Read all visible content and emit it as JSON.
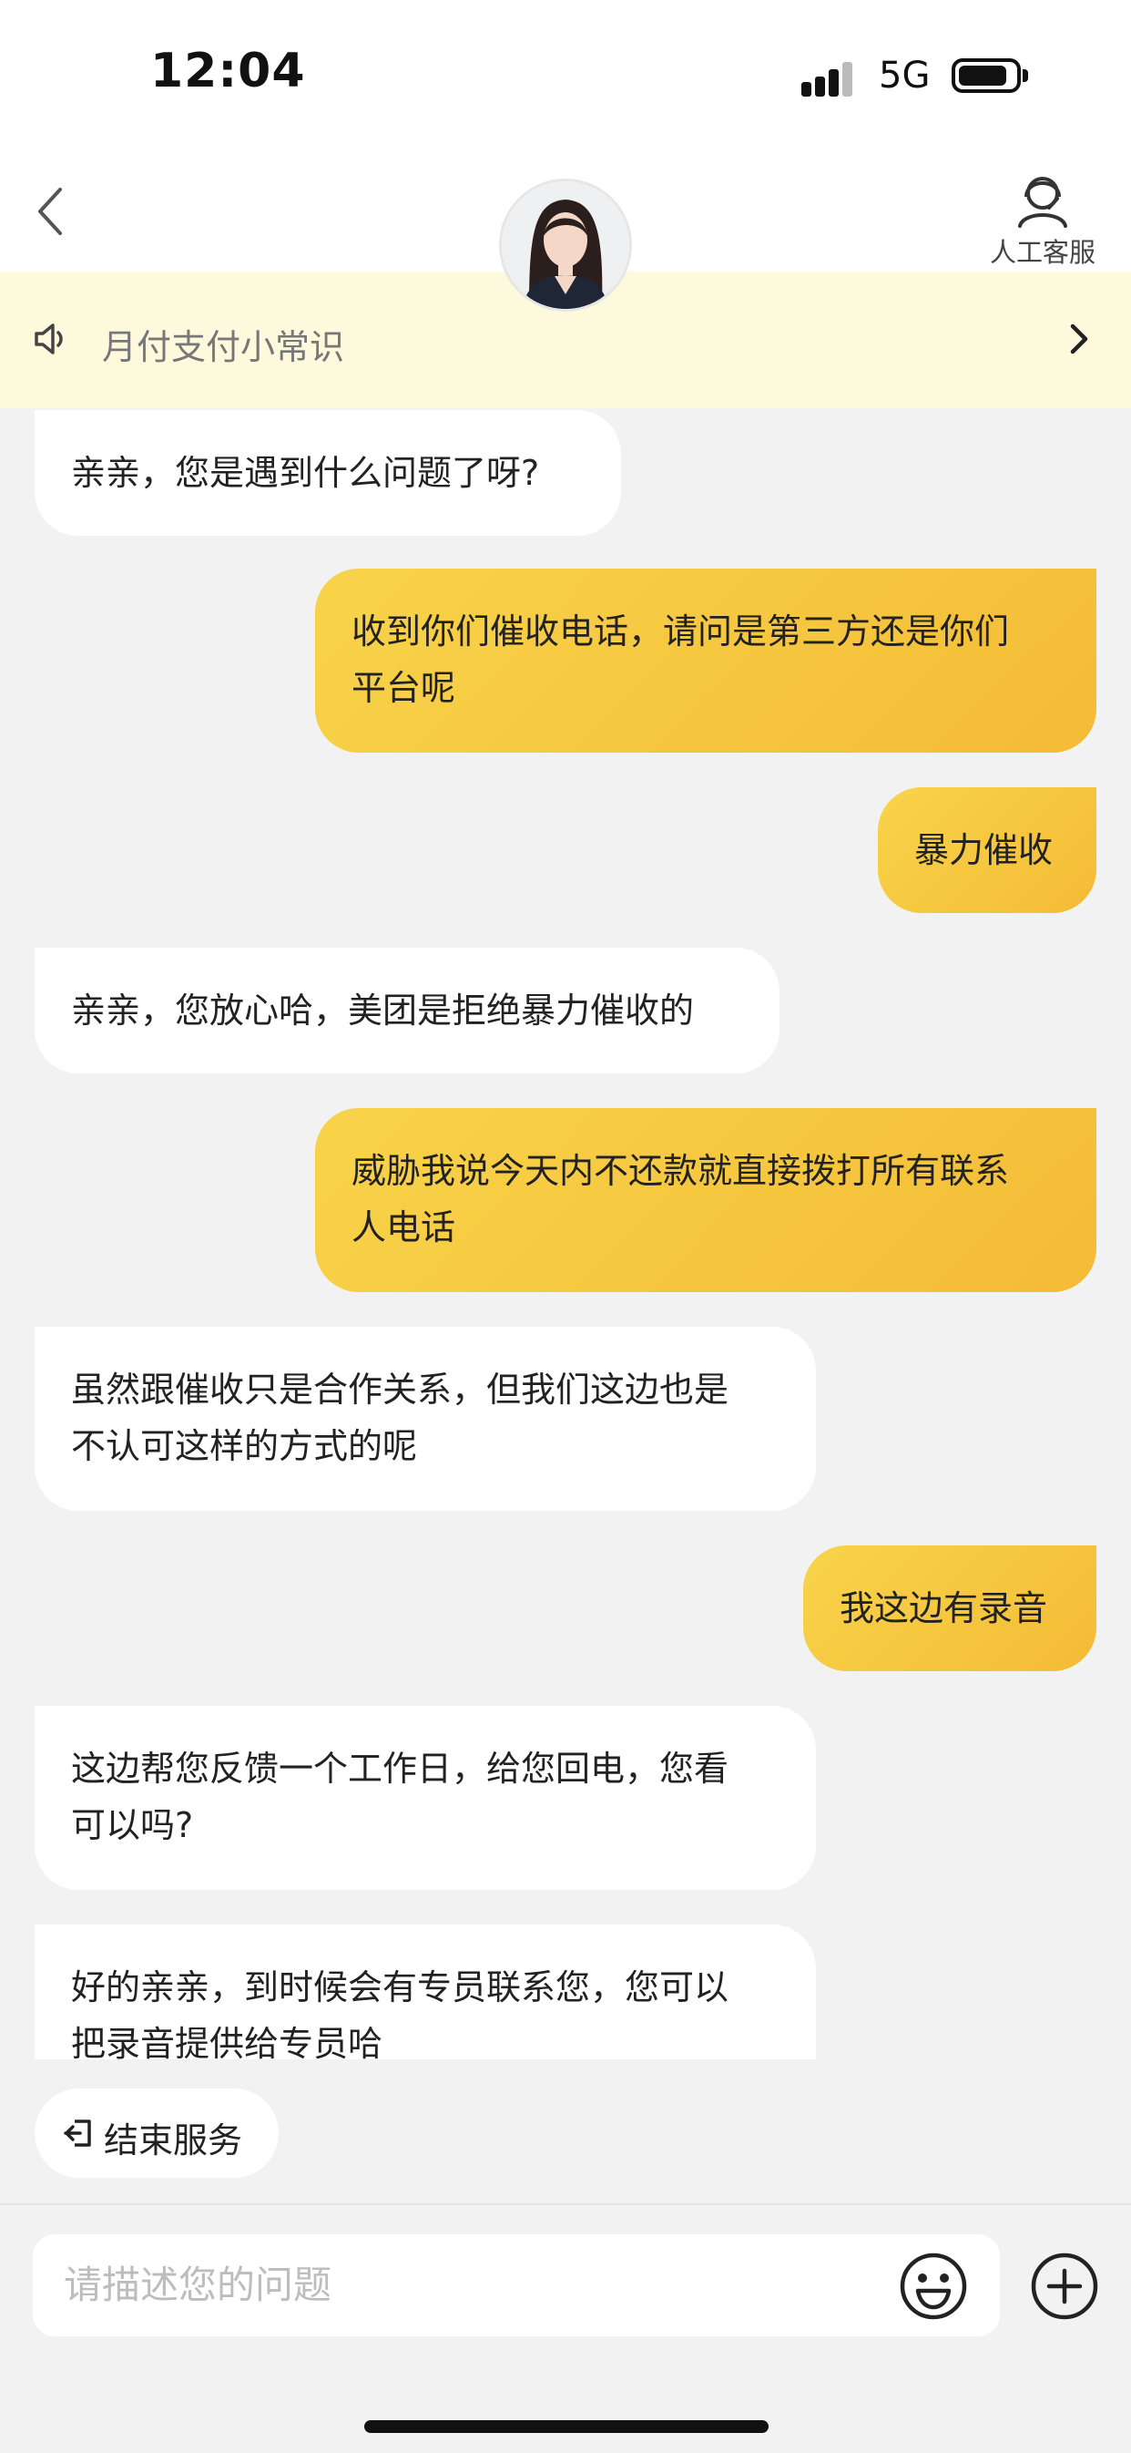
{
  "status_bar": {
    "time": "12:04",
    "network": "5G"
  },
  "header": {
    "agent_label": "人工客服"
  },
  "notice": {
    "text": "月付支付小常识"
  },
  "messages": [
    {
      "from": "agent",
      "text": "亲亲，您是遇到什么问题了呀?"
    },
    {
      "from": "user",
      "text": "收到你们催收电话，请问是第三方还是你们\n平台呢"
    },
    {
      "from": "user",
      "text": "暴力催收"
    },
    {
      "from": "agent",
      "text": "亲亲，您放心哈，美团是拒绝暴力催收的"
    },
    {
      "from": "user",
      "text": "威胁我说今天内不还款就直接拨打所有联系\n人电话"
    },
    {
      "from": "agent",
      "text": "虽然跟催收只是合作关系，但我们这边也是\n不认可这样的方式的呢"
    },
    {
      "from": "user",
      "text": "我这边有录音"
    },
    {
      "from": "agent",
      "text": "这边帮您反馈一个工作日，给您回电，您看\n可以吗?"
    },
    {
      "from": "agent",
      "text": "好的亲亲，到时候会有专员联系您，您可以\n把录音提供给专员哈"
    }
  ],
  "end_service": {
    "label": "结束服务"
  },
  "input": {
    "placeholder": "请描述您的问题",
    "value": ""
  },
  "colors": {
    "accent": "#f6c53f",
    "notice_bg": "#fdf9dd",
    "background": "#f2f2f2"
  },
  "icons": [
    "back-arrow-icon",
    "customer-service-icon",
    "speaker-icon",
    "chevron-right-icon",
    "exit-icon",
    "emoji-icon",
    "plus-icon"
  ]
}
